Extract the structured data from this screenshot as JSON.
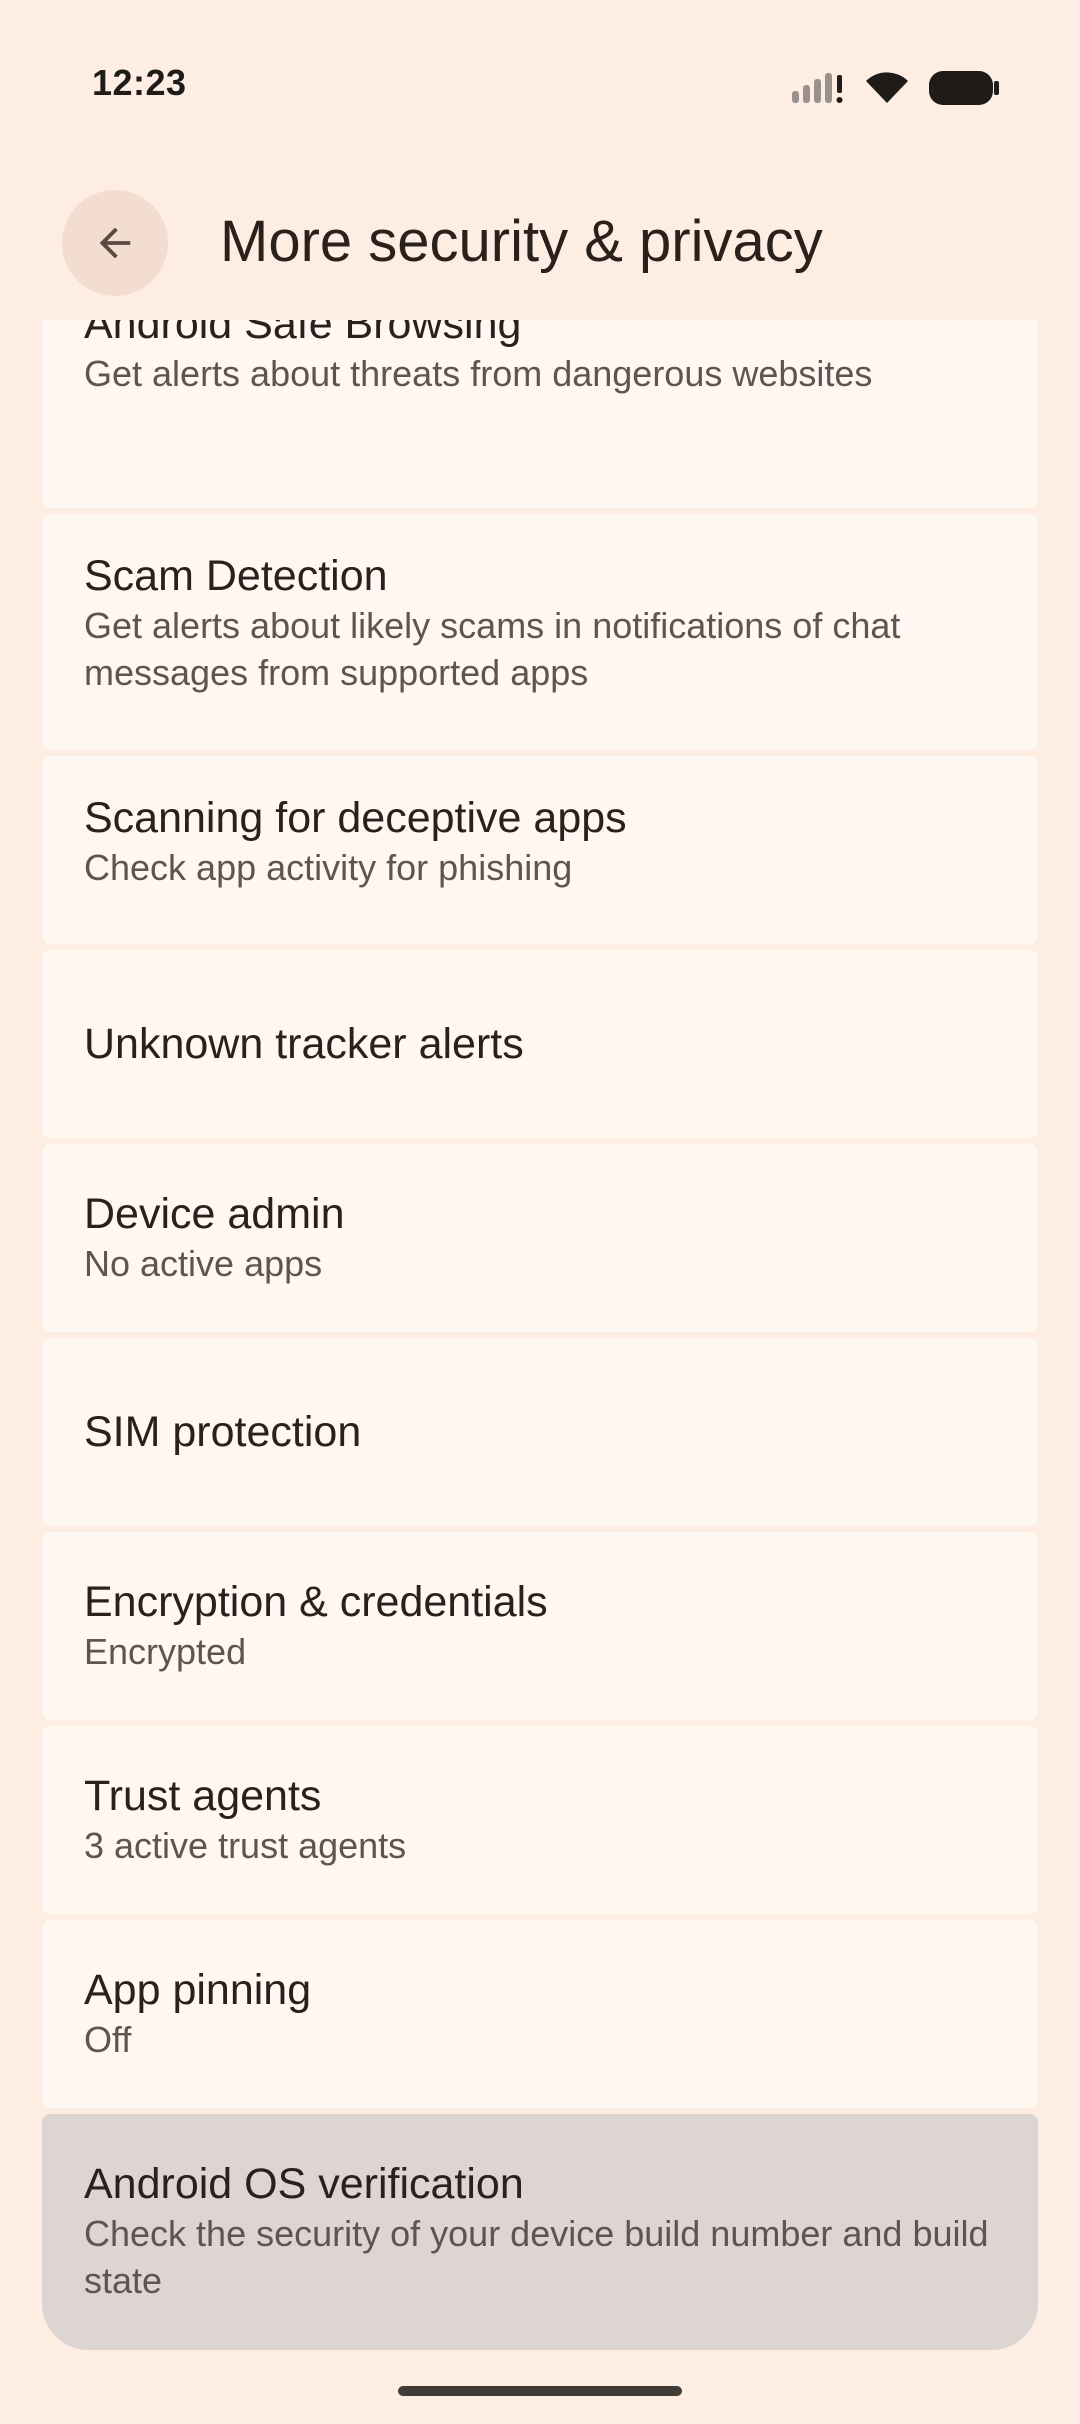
{
  "status_bar": {
    "time": "12:23",
    "icons": [
      "signal-icon",
      "wifi-icon",
      "battery-icon"
    ]
  },
  "header": {
    "back_icon": "arrow-left-icon",
    "title": "More security & privacy"
  },
  "items": [
    {
      "title": "Android Safe Browsing",
      "subtitle": "Get alerts about threats from dangerous websites"
    },
    {
      "title": "Scam Detection",
      "subtitle": "Get alerts about likely scams in notifications of chat messages from supported apps"
    },
    {
      "title": "Scanning for deceptive apps",
      "subtitle": "Check app activity for phishing"
    },
    {
      "title": "Unknown tracker alerts",
      "subtitle": ""
    },
    {
      "title": "Device admin",
      "subtitle": "No active apps"
    },
    {
      "title": "SIM protection",
      "subtitle": ""
    },
    {
      "title": "Encryption & credentials",
      "subtitle": "Encrypted"
    },
    {
      "title": "Trust agents",
      "subtitle": "3 active trust agents"
    },
    {
      "title": "App pinning",
      "subtitle": "Off"
    },
    {
      "title": "Android OS verification",
      "subtitle": "Check the security of your device build number and build state"
    }
  ],
  "colors": {
    "background": "#fdede2",
    "card": "#fff7f2",
    "card_pressed": "#dcd5d2",
    "title_text": "#2a211c",
    "subtitle_text": "#5f5550"
  }
}
